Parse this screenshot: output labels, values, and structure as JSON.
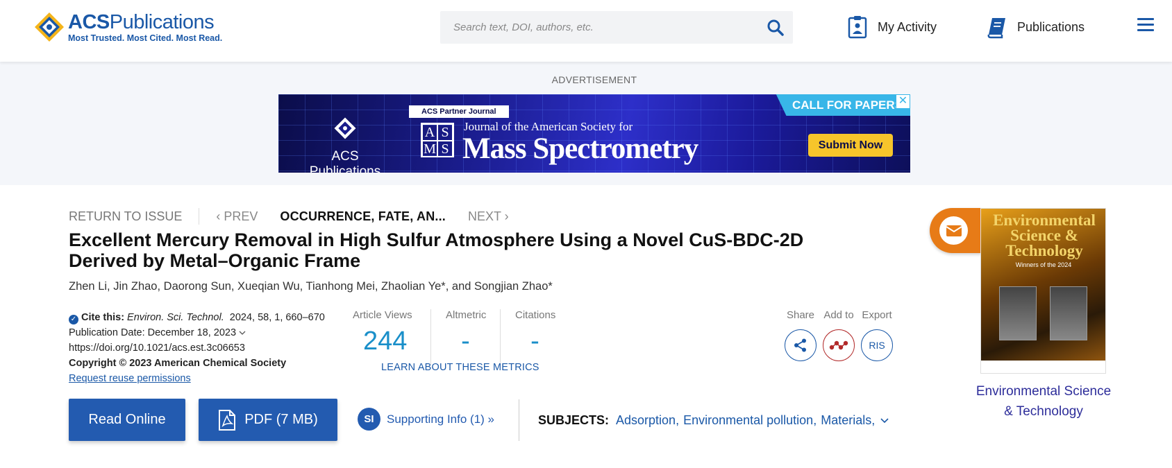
{
  "header": {
    "logo_name_bold": "ACS",
    "logo_name_rest": "Publications",
    "logo_tagline": "Most Trusted. Most Cited. Most Read.",
    "search_placeholder": "Search text, DOI, authors, etc.",
    "nav": [
      {
        "label": "My Activity",
        "icon": "clipboard-icon"
      },
      {
        "label": "Publications",
        "icon": "book-icon"
      }
    ],
    "menu_icon": "hamburger-menu-icon"
  },
  "advertisement": {
    "label": "ADVERTISEMENT",
    "publisher": "ACS Publications",
    "partner_tag": "ACS Partner Journal",
    "asms_letters": [
      "A",
      "S",
      "M",
      "S"
    ],
    "journal_line1": "Journal of the American Society for",
    "journal_line2": "Mass Spectrometry",
    "call_for_papers": "CALL FOR PAPERS",
    "submit": "Submit Now",
    "close": "✕"
  },
  "breadcrumbs": {
    "return": "RETURN TO ISSUE",
    "prev": "‹ PREV",
    "current": "OCCURRENCE, FATE, AN...",
    "next": "NEXT ›"
  },
  "article": {
    "title": "Excellent Mercury Removal in High Sulfur Atmosphere Using a Novel CuS-BDC-2D Derived by Metal–Organic Frame",
    "authors": "Zhen Li, Jin Zhao, Daorong Sun, Xueqian Wu, Tianhong Mei, Zhaolian Ye*, and Songjian Zhao*",
    "cite_label": "Cite this:",
    "cite_journal": "Environ. Sci. Technol.",
    "cite_details": "2024, 58, 1, 660–670",
    "publication_date": "Publication Date: December 18, 2023",
    "doi": "https://doi.org/10.1021/acs.est.3c06653",
    "copyright": "Copyright © 2023 American Chemical Society",
    "reuse": "Request reuse permissions"
  },
  "metrics": {
    "items": [
      {
        "label": "Article Views",
        "value": "244"
      },
      {
        "label": "Altmetric",
        "value": "-"
      },
      {
        "label": "Citations",
        "value": "-"
      }
    ],
    "learn_more": "LEARN ABOUT THESE METRICS"
  },
  "tools": [
    {
      "label": "Share",
      "icon": "share-icon"
    },
    {
      "label": "Add to",
      "icon": "molecule-icon"
    },
    {
      "label": "Export",
      "icon": "RIS"
    }
  ],
  "actions": {
    "read_online": "Read Online",
    "pdf": "PDF (7 MB)",
    "si_badge": "SI",
    "supporting_info": "Supporting Info (1) »"
  },
  "subjects": {
    "label": "SUBJECTS:",
    "items": [
      "Adsorption,",
      "Environmental pollution,",
      "Materials,"
    ]
  },
  "sidebar": {
    "cover_title": "Environmental Science & Technology",
    "cover_subtitle": "Winners of the 2024",
    "journal_link_line1": "Environmental Science",
    "journal_link_line2": "& Technology",
    "mail_icon": "envelope-icon"
  },
  "colors": {
    "brand_blue": "#1a58a7",
    "button_blue": "#235bb0",
    "metric_blue": "#1a8fc9",
    "mail_orange": "#e77b17"
  }
}
